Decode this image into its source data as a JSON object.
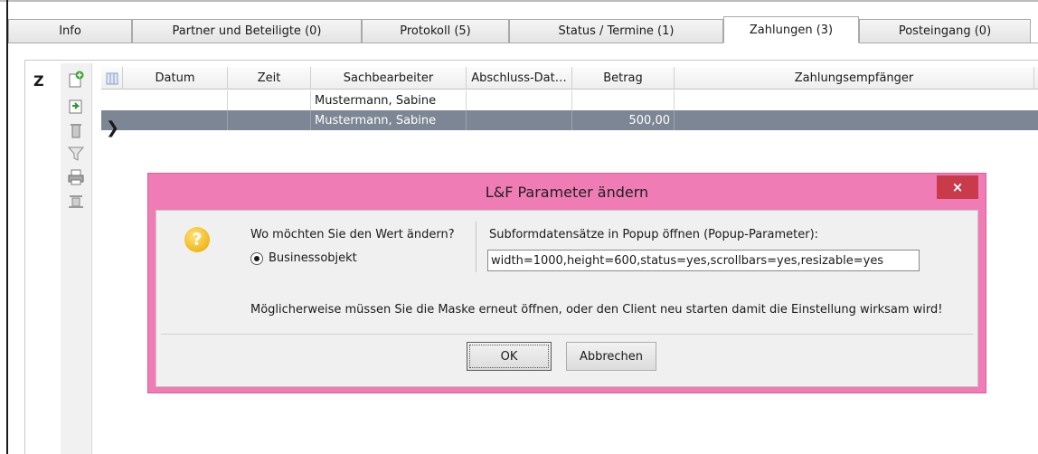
{
  "tabs": [
    {
      "label": "Info",
      "active": false
    },
    {
      "label": "Partner und Beteiligte (0)",
      "active": false
    },
    {
      "label": "Protokoll (5)",
      "active": false
    },
    {
      "label": "Status / Termine (1)",
      "active": false
    },
    {
      "label": "Zahlungen (3)",
      "active": true
    },
    {
      "label": "Posteingang (0)",
      "active": false
    }
  ],
  "panel": {
    "label": "Z"
  },
  "toolbar": {
    "icons": [
      "add-record-icon",
      "edit-record-icon",
      "delete-icon",
      "filter-icon",
      "print-icon",
      "export-icon"
    ]
  },
  "grid": {
    "columns": [
      "Datum",
      "Zeit",
      "Sachbearbeiter",
      "Abschluss-Dat…",
      "Betrag",
      "Zahlungsempfänger"
    ],
    "rows": [
      {
        "datum": "",
        "zeit": "",
        "sachbearbeiter": "Mustermann, Sabine",
        "abschluss": "",
        "betrag": "",
        "empfaenger": "",
        "selected": false
      },
      {
        "datum": "",
        "zeit": "",
        "sachbearbeiter": "Mustermann, Sabine",
        "abschluss": "",
        "betrag": "500,00",
        "empfaenger": "",
        "selected": true
      }
    ],
    "current_row_marker": "❯"
  },
  "dialog": {
    "title": "L&F Parameter ändern",
    "close_label": "×",
    "question": "Wo möchten Sie den Wert ändern?",
    "radio_label": "Businessobjekt",
    "radio_checked": true,
    "field_label": "Subformdatensätze in Popup öffnen (Popup-Parameter):",
    "field_value": "width=1000,height=600,status=yes,scrollbars=yes,resizable=yes",
    "notice": "Möglicherweise müssen Sie die Maske erneut öffnen, oder den Client neu starten damit die Einstellung wirksam wird!",
    "ok_label": "OK",
    "cancel_label": "Abbrechen",
    "accent_color": "#f07cb6",
    "close_color": "#c93a4a"
  }
}
